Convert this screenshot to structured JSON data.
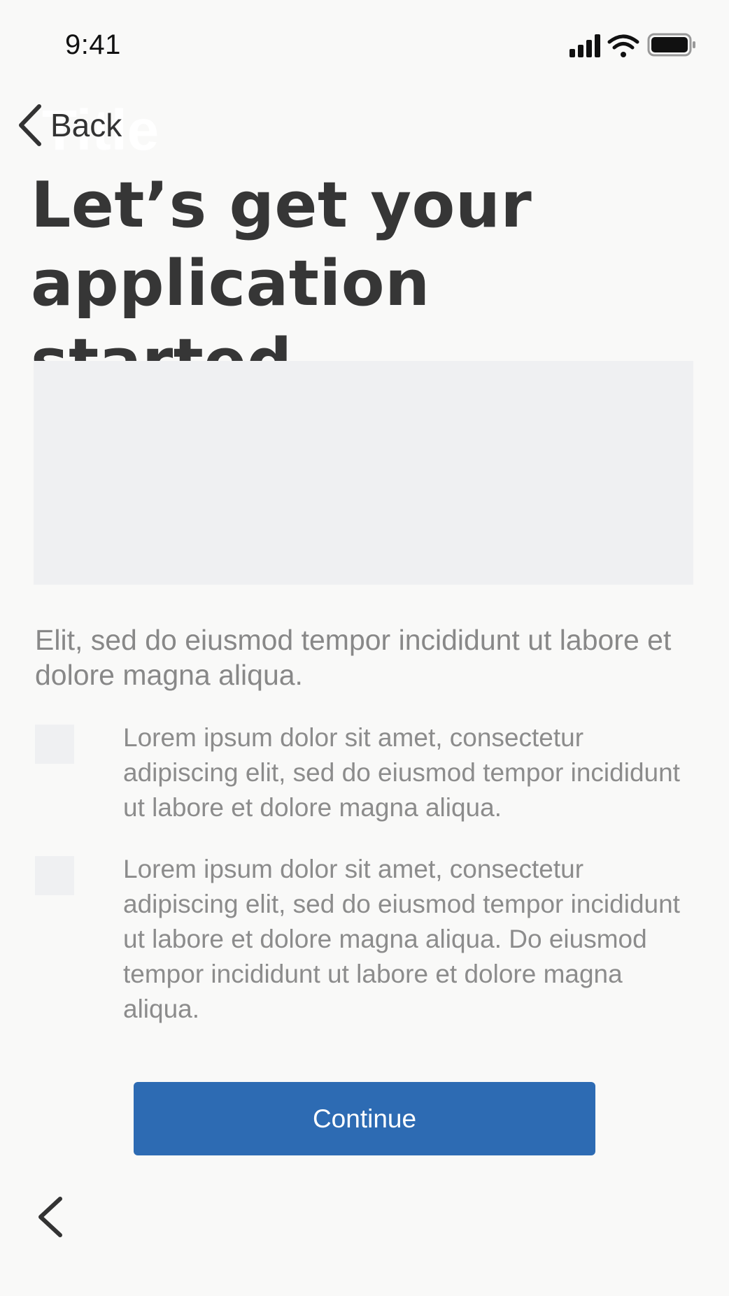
{
  "status_bar": {
    "time": "9:41",
    "icons": [
      "cellular-signal-icon",
      "wifi-icon",
      "battery-icon"
    ]
  },
  "nav": {
    "back_label": "Back",
    "back_icon": "chevron-left-icon",
    "title": "Title"
  },
  "main": {
    "title": "Let’s get your application started",
    "intro": "Elit, sed do eiusmod tempor incididunt ut labore et dolore magna aliqua.",
    "items": [
      {
        "text": "Lorem ipsum dolor sit amet, consectetur adipiscing elit, sed do eiusmod tempor incididunt ut labore et dolore magna aliqua."
      },
      {
        "text": "Lorem ipsum dolor sit amet, consectetur adipiscing elit, sed do eiusmod tempor incididunt ut labore et dolore magna aliqua. Do eiusmod tempor incididunt ut labore et dolore magna aliqua."
      }
    ],
    "continue_label": "Continue"
  },
  "footer": {
    "back_icon": "chevron-left-icon"
  },
  "colors": {
    "background": "#f9f9f8",
    "primary_button": "#2d6bb3",
    "placeholder": "#eff0f2",
    "title_text": "#363636",
    "body_text": "#888888"
  }
}
